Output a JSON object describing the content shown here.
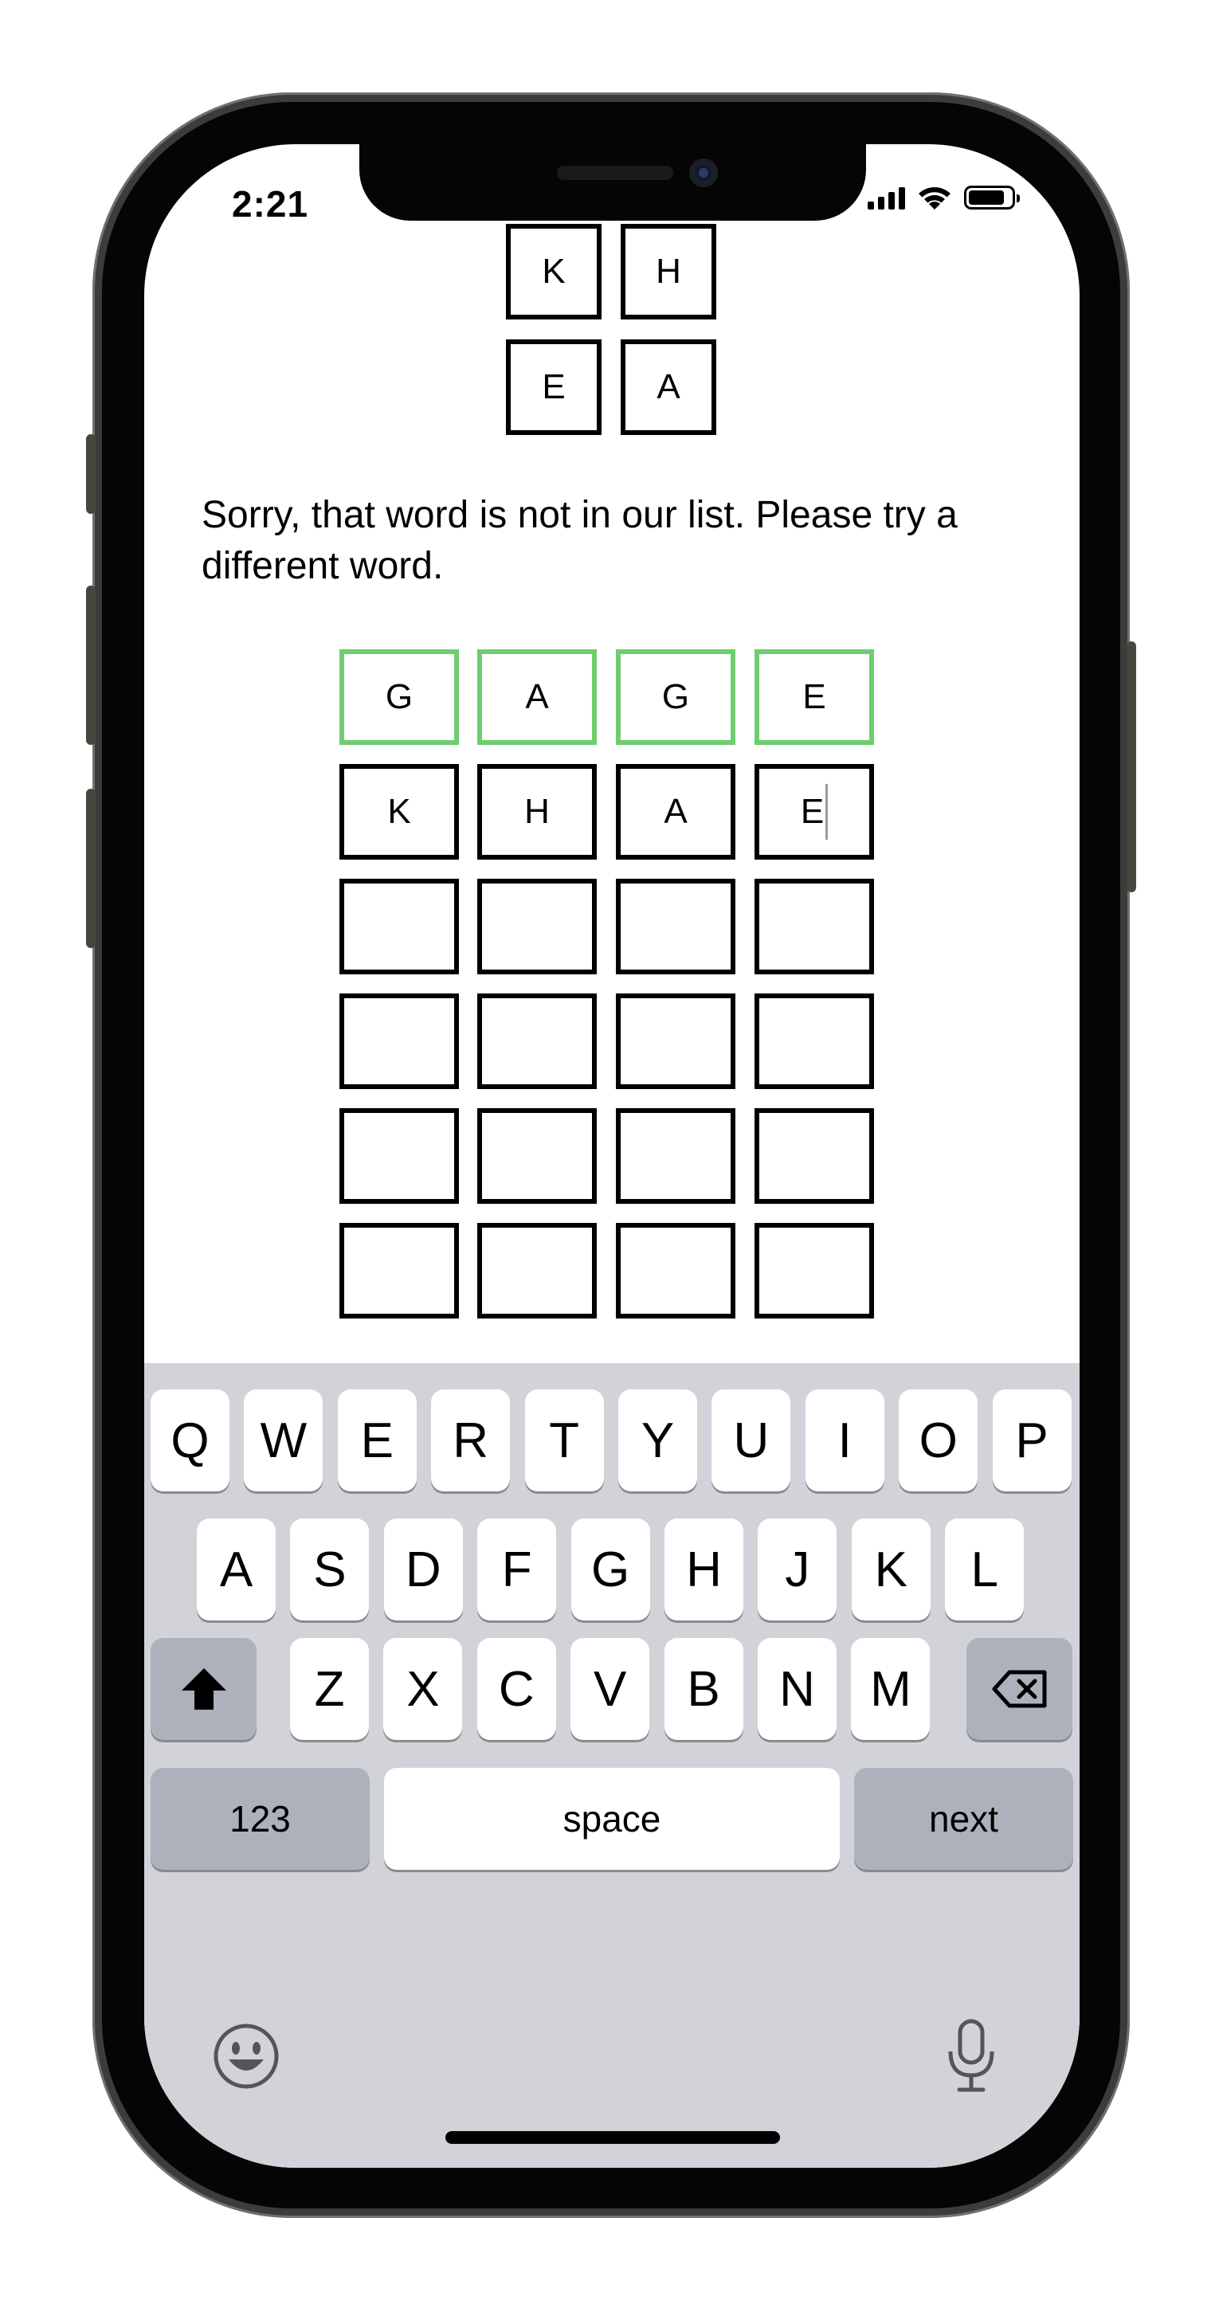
{
  "status_bar": {
    "time": "2:21",
    "icons": [
      "signal-icon",
      "wifi-icon",
      "battery-icon"
    ]
  },
  "hint_tiles": [
    [
      "K",
      "H"
    ],
    [
      "E",
      "A"
    ]
  ],
  "message": "Sorry, that word is not in our list. Please try a different word.",
  "colors": {
    "correct": "#6fcd6f",
    "tile_border": "#000000",
    "keyboard_bg": "#d1d3d9",
    "special_key": "#adb1bb"
  },
  "board": {
    "rows": [
      {
        "letters": [
          "G",
          "A",
          "G",
          "E"
        ],
        "state": "correct"
      },
      {
        "letters": [
          "K",
          "H",
          "A",
          "E"
        ],
        "state": "editing"
      },
      {
        "letters": [
          "",
          "",
          "",
          ""
        ],
        "state": "empty"
      },
      {
        "letters": [
          "",
          "",
          "",
          ""
        ],
        "state": "empty"
      },
      {
        "letters": [
          "",
          "",
          "",
          ""
        ],
        "state": "empty"
      },
      {
        "letters": [
          "",
          "",
          "",
          ""
        ],
        "state": "empty"
      }
    ]
  },
  "keyboard": {
    "row1": [
      "Q",
      "W",
      "E",
      "R",
      "T",
      "Y",
      "U",
      "I",
      "O",
      "P"
    ],
    "row2": [
      "A",
      "S",
      "D",
      "F",
      "G",
      "H",
      "J",
      "K",
      "L"
    ],
    "row3": [
      "Z",
      "X",
      "C",
      "V",
      "B",
      "N",
      "M"
    ],
    "numbers_label": "123",
    "space_label": "space",
    "next_label": "next",
    "icons": [
      "shift-icon",
      "backspace-icon",
      "emoji-icon",
      "microphone-icon"
    ]
  }
}
